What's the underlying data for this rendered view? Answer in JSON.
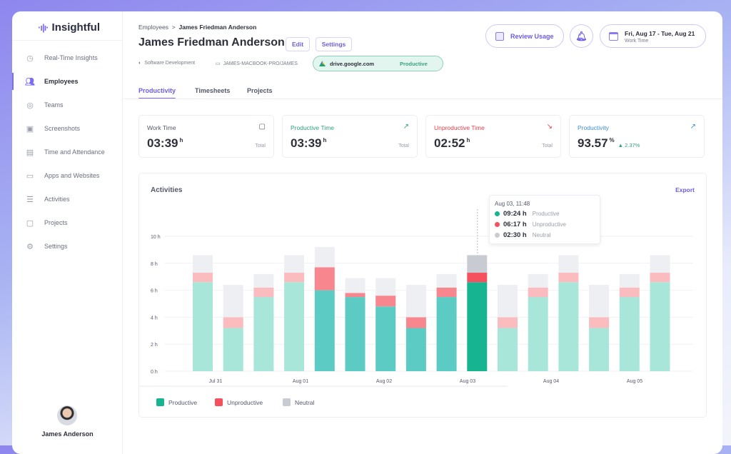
{
  "brand": {
    "name": "Insightful"
  },
  "sidebar": {
    "items": [
      {
        "label": "Real-Time Insights",
        "icon": "clock-icon",
        "active": false
      },
      {
        "label": "Employees",
        "icon": "users-icon",
        "active": true
      },
      {
        "label": "Teams",
        "icon": "teams-icon",
        "active": false
      },
      {
        "label": "Screenshots",
        "icon": "screenshots-icon",
        "active": false
      },
      {
        "label": "Time and Attendance",
        "icon": "calendar-icon",
        "active": false
      },
      {
        "label": "Apps and Websites",
        "icon": "monitor-icon",
        "active": false
      },
      {
        "label": "Activities",
        "icon": "list-icon",
        "active": false
      },
      {
        "label": "Projects",
        "icon": "briefcase-icon",
        "active": false
      },
      {
        "label": "Settings",
        "icon": "gear-icon",
        "active": false
      }
    ],
    "user": "James Anderson"
  },
  "header": {
    "breadcrumb": {
      "parent": "Employees",
      "separator": ">",
      "current": "James Friedman Anderson"
    },
    "title": "James Friedman Anderson",
    "edit": "Edit",
    "settings": "Settings",
    "team": "Software Development",
    "computer": "JAMES-MACBOOK-PRO/JAMES",
    "current_app": {
      "url": "drive.google.com",
      "status": "Productive"
    },
    "review_usage": "Review Usage",
    "date_range": "Fri, Aug 17 - Tue, Aug 21",
    "date_sub": "Work Time"
  },
  "tabs": [
    "Productivity",
    "Timesheets",
    "Projects"
  ],
  "cards": [
    {
      "label": "Work Time",
      "value": "03:39",
      "unit": "h",
      "foot": "Total",
      "color": "#55586a",
      "icon": "clipboard-icon"
    },
    {
      "label": "Productive Time",
      "value": "03:39",
      "unit": "h",
      "foot": "Total",
      "color": "#2f9f7e",
      "icon": "trend-up-icon"
    },
    {
      "label": "Unproductive Time",
      "value": "02:52",
      "unit": "h",
      "foot": "Total",
      "color": "#e0404e",
      "icon": "trend-down-icon"
    },
    {
      "label": "Productivity",
      "value": "93.57",
      "unit": "%",
      "change": "▲ 2.37%",
      "color": "#3d8fd6",
      "icon": "trend-up-icon"
    }
  ],
  "activities": {
    "title": "Activities",
    "export": "Export",
    "tooltip": {
      "header": "Aug 03, 11:48",
      "rows": [
        {
          "value": "09:24 h",
          "name": "Productive",
          "color": "#17b492"
        },
        {
          "value": "06:17 h",
          "name": "Unproductive",
          "color": "#f4505d"
        },
        {
          "value": "02:30 h",
          "name": "Neutral",
          "color": "#c8ccd2"
        }
      ]
    },
    "legend": [
      "Productive",
      "Unproductive",
      "Neutral"
    ]
  },
  "chart_data": {
    "type": "bar",
    "stacked": true,
    "y_ticks": [
      "0 h",
      "2 h",
      "4 h",
      "6 h",
      "8 h",
      "10 h"
    ],
    "ylim": [
      0,
      10
    ],
    "x_labels": [
      "Jul 31",
      "Aug 01",
      "Aug 02",
      "Aug 03",
      "Aug 04",
      "Aug 05"
    ],
    "series": [
      {
        "name": "Productive",
        "values": [
          6.6,
          3.2,
          5.5,
          6.6,
          6.0,
          5.5,
          4.8,
          3.2,
          5.5,
          6.6,
          3.2,
          5.5,
          6.6,
          3.2,
          5.5,
          6.6
        ]
      },
      {
        "name": "Unproductive",
        "values": [
          0.7,
          0.8,
          0.7,
          0.7,
          1.7,
          0.3,
          0.8,
          0.8,
          0.7,
          0.7,
          0.8,
          0.7,
          0.7,
          0.8,
          0.7,
          0.7
        ]
      },
      {
        "name": "Neutral",
        "values": [
          1.3,
          2.4,
          1.0,
          1.3,
          1.5,
          1.1,
          1.3,
          2.4,
          1.0,
          1.3,
          2.4,
          1.0,
          1.3,
          2.4,
          1.0,
          1.3
        ]
      }
    ],
    "highlighted_range": [
      4,
      9
    ],
    "selected_bar": 9,
    "grid": true,
    "legend": "bottom-left",
    "colors": {
      "productive": [
        "#a8e6d9",
        "#5ccbc3",
        "#17b492"
      ],
      "unproductive": [
        "#fbbcc0",
        "#f7868f",
        "#f4505d"
      ],
      "neutral": [
        "#eeeff2",
        "#eeeff2",
        "#c8ccd2"
      ]
    }
  }
}
